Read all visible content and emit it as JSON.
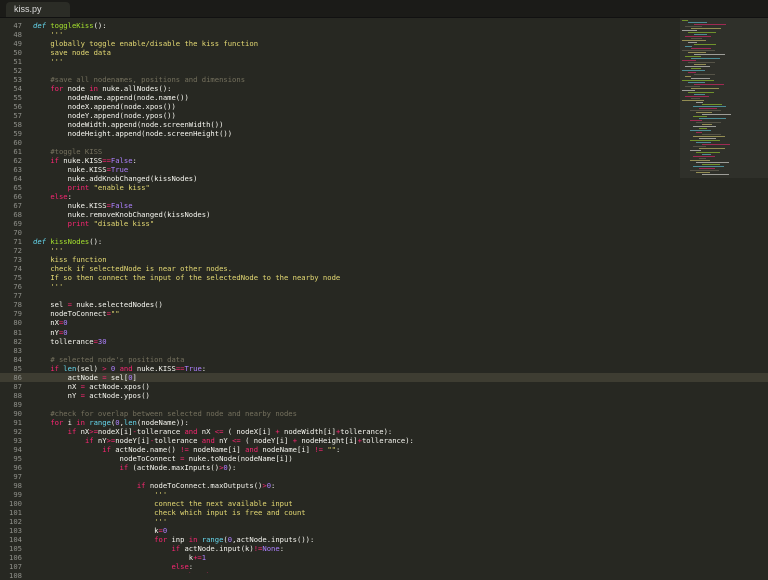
{
  "tab": {
    "label": "kiss.py"
  },
  "code_lines": [
    {
      "n": "47",
      "t": "<span class=\"de\">def</span> <span class=\"fn\">toggleKiss</span>():"
    },
    {
      "n": "48",
      "t": "    <span class=\"st\">'''</span>"
    },
    {
      "n": "49",
      "t": "    <span class=\"st\">globally toggle enable/disable the kiss function</span>"
    },
    {
      "n": "50",
      "t": "    <span class=\"st\">save node data</span>"
    },
    {
      "n": "51",
      "t": "    <span class=\"st\">'''</span>"
    },
    {
      "n": "52",
      "t": ""
    },
    {
      "n": "53",
      "t": "    <span class=\"co\">#save all nodenames, positions and dimensions</span>"
    },
    {
      "n": "54",
      "t": "    <span class=\"kw\">for</span> node <span class=\"kw\">in</span> nuke.allNodes():"
    },
    {
      "n": "55",
      "t": "        nodeName.append(node.name())"
    },
    {
      "n": "56",
      "t": "        nodeX.append(node.xpos())"
    },
    {
      "n": "57",
      "t": "        nodeY.append(node.ypos())"
    },
    {
      "n": "58",
      "t": "        nodeWidth.append(node.screenWidth())"
    },
    {
      "n": "59",
      "t": "        nodeHeight.append(node.screenHeight())"
    },
    {
      "n": "60",
      "t": ""
    },
    {
      "n": "61",
      "t": "    <span class=\"co\">#toggle KISS</span>"
    },
    {
      "n": "62",
      "t": "    <span class=\"kw\">if</span> nuke.KISS<span class=\"op\">==</span><span class=\"nu\">False</span>:"
    },
    {
      "n": "63",
      "t": "        nuke.KISS<span class=\"op\">=</span><span class=\"nu\">True</span>"
    },
    {
      "n": "64",
      "t": "        nuke.addKnobChanged(kissNodes)"
    },
    {
      "n": "65",
      "t": "        <span class=\"kw\">print</span> <span class=\"st\">\"enable kiss\"</span>"
    },
    {
      "n": "66",
      "t": "    <span class=\"kw\">else</span>:"
    },
    {
      "n": "67",
      "t": "        nuke.KISS<span class=\"op\">=</span><span class=\"nu\">False</span>"
    },
    {
      "n": "68",
      "t": "        nuke.removeKnobChanged(kissNodes)"
    },
    {
      "n": "69",
      "t": "        <span class=\"kw\">print</span> <span class=\"st\">\"disable kiss\"</span>"
    },
    {
      "n": "70",
      "t": ""
    },
    {
      "n": "71",
      "t": "<span class=\"de\">def</span> <span class=\"fn\">kissNodes</span>():"
    },
    {
      "n": "72",
      "t": "    <span class=\"st\">'''</span>"
    },
    {
      "n": "73",
      "t": "    <span class=\"st\">kiss function</span>"
    },
    {
      "n": "74",
      "t": "    <span class=\"st\">check if selectedNode is near other nodes.</span>"
    },
    {
      "n": "75",
      "t": "    <span class=\"st\">If so then connect the input of the selectedNode to the nearby node</span>"
    },
    {
      "n": "76",
      "t": "    <span class=\"st\">'''</span>"
    },
    {
      "n": "77",
      "t": ""
    },
    {
      "n": "78",
      "t": "    sel <span class=\"op\">=</span> nuke.selectedNodes()"
    },
    {
      "n": "79",
      "t": "    nodeToConnect<span class=\"op\">=</span><span class=\"st\">\"\"</span>"
    },
    {
      "n": "80",
      "t": "    nX<span class=\"op\">=</span><span class=\"nu\">0</span>"
    },
    {
      "n": "81",
      "t": "    nY<span class=\"op\">=</span><span class=\"nu\">0</span>"
    },
    {
      "n": "82",
      "t": "    tollerance<span class=\"op\">=</span><span class=\"nu\">30</span>"
    },
    {
      "n": "83",
      "t": ""
    },
    {
      "n": "84",
      "t": "    <span class=\"co\"># selected node's position data</span>"
    },
    {
      "n": "85",
      "t": "    <span class=\"kw\">if</span> <span class=\"bi\">len</span>(sel) <span class=\"op\">&gt;</span> <span class=\"nu\">0</span> <span class=\"kw\">and</span> nuke.KISS<span class=\"op\">==</span><span class=\"nu\">True</span>:"
    },
    {
      "n": "86",
      "t": "        actNode <span class=\"op\">=</span> sel[<span class=\"nu\">0</span>]"
    },
    {
      "n": "87",
      "t": "        nX <span class=\"op\">=</span> actNode.xpos()"
    },
    {
      "n": "88",
      "t": "        nY <span class=\"op\">=</span> actNode.ypos()"
    },
    {
      "n": "89",
      "t": ""
    },
    {
      "n": "90",
      "t": "    <span class=\"co\">#check for overlap between selected node and nearby nodes</span>"
    },
    {
      "n": "91",
      "t": "    <span class=\"kw\">for</span> i <span class=\"kw\">in</span> <span class=\"bi\">range</span>(<span class=\"nu\">0</span>,<span class=\"bi\">len</span>(nodeName)):"
    },
    {
      "n": "92",
      "t": "        <span class=\"kw\">if</span> nX<span class=\"op\">&gt;=</span>nodeX[i]<span class=\"op\">-</span>tollerance <span class=\"kw\">and</span> nX <span class=\"op\">&lt;=</span> ( nodeX[i] <span class=\"op\">+</span> nodeWidth[i]<span class=\"op\">+</span>tollerance):"
    },
    {
      "n": "93",
      "t": "            <span class=\"kw\">if</span> nY<span class=\"op\">&gt;=</span>nodeY[i]<span class=\"op\">-</span>tollerance <span class=\"kw\">and</span> nY <span class=\"op\">&lt;=</span> ( nodeY[i] <span class=\"op\">+</span> nodeHeight[i]<span class=\"op\">+</span>tollerance):"
    },
    {
      "n": "94",
      "t": "                <span class=\"kw\">if</span> actNode.name() <span class=\"op\">!=</span> nodeName[i] <span class=\"kw\">and</span> nodeName[i] <span class=\"op\">!=</span> <span class=\"st\">\"\"</span>:"
    },
    {
      "n": "95",
      "t": "                    nodeToConnect <span class=\"op\">=</span> nuke.toNode(nodeName[i])"
    },
    {
      "n": "96",
      "t": "                    <span class=\"kw\">if</span> (actNode.maxInputs()<span class=\"op\">&gt;</span><span class=\"nu\">0</span>):"
    },
    {
      "n": "97",
      "t": ""
    },
    {
      "n": "98",
      "t": "                        <span class=\"kw\">if</span> nodeToConnect.maxOutputs()<span class=\"op\">&gt;</span><span class=\"nu\">0</span>:"
    },
    {
      "n": "99",
      "t": "                            <span class=\"st\">'''</span>"
    },
    {
      "n": "100",
      "t": "                            <span class=\"st\">connect the next available input</span>"
    },
    {
      "n": "101",
      "t": "                            <span class=\"st\">check which input is free and count</span>"
    },
    {
      "n": "102",
      "t": "                            <span class=\"st\">'''</span>"
    },
    {
      "n": "103",
      "t": "                            k<span class=\"op\">=</span><span class=\"nu\">0</span>"
    },
    {
      "n": "104",
      "t": "                            <span class=\"kw\">for</span> inp <span class=\"kw\">in</span> <span class=\"bi\">range</span>(<span class=\"nu\">0</span>,actNode.inputs()):"
    },
    {
      "n": "105",
      "t": "                                <span class=\"kw\">if</span> actNode.input(k)<span class=\"op\">!=</span><span class=\"nu\">None</span>:"
    },
    {
      "n": "106",
      "t": "                                    k<span class=\"op\">+=</span><span class=\"nu\">1</span>"
    },
    {
      "n": "107",
      "t": "                                <span class=\"kw\">else</span>:"
    },
    {
      "n": "108",
      "t": "                                    <span class=\"kw\">break</span>"
    }
  ],
  "current_line": "86"
}
